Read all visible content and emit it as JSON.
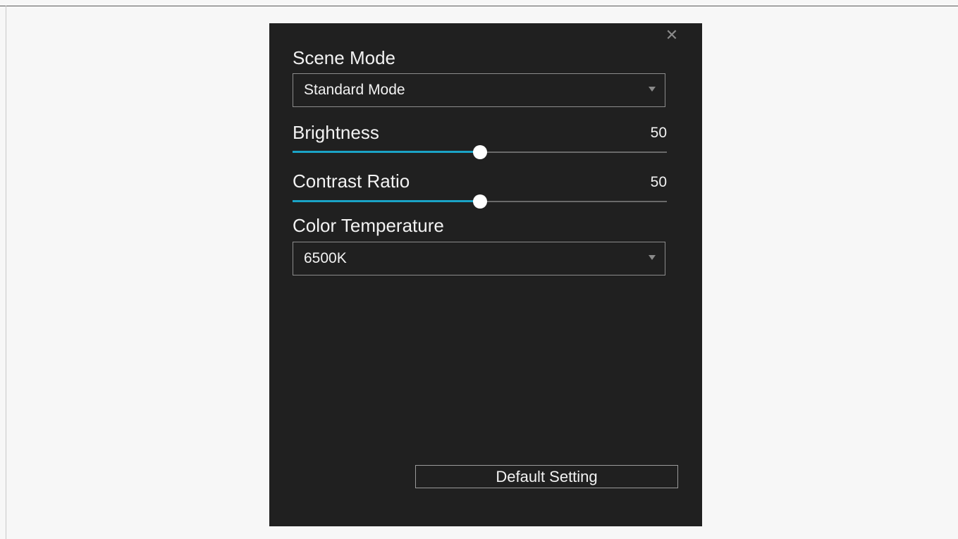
{
  "panel": {
    "close_symbol": "✕",
    "scene_mode": {
      "label": "Scene Mode",
      "selected": "Standard Mode"
    },
    "brightness": {
      "label": "Brightness",
      "value": "50",
      "level": 0.5
    },
    "contrast": {
      "label": "Contrast Ratio",
      "value": "50",
      "level": 0.5
    },
    "color_temperature": {
      "label": "Color Temperature",
      "selected": "6500K"
    },
    "default_button_label": "Default Setting"
  },
  "colors": {
    "panel_bg": "#202020",
    "accent": "#1aa3c6",
    "text": "#f2f2f2"
  }
}
